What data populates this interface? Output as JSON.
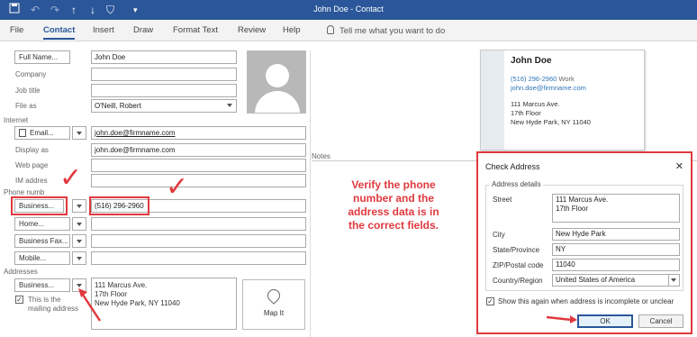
{
  "window": {
    "title": "John Doe  -  Contact"
  },
  "quick_access": [
    "save-icon",
    "undo-icon",
    "redo-icon",
    "up-arrow-icon",
    "down-arrow-icon",
    "tag-icon",
    "customize-icon"
  ],
  "ribbon": {
    "tabs": [
      "File",
      "Contact",
      "Insert",
      "Draw",
      "Format Text",
      "Review",
      "Help"
    ],
    "active_tab": "Contact",
    "tell_me": "Tell me what you want to do"
  },
  "form": {
    "full_name_button": "Full Name...",
    "full_name": "John Doe",
    "company_label": "Company",
    "company": "",
    "job_title_label": "Job title",
    "job_title": "",
    "file_as_label": "File as",
    "file_as": "O'Neill, Robert",
    "internet_section": "Internet",
    "email_button": "Email...",
    "email": "john.doe@firmname.com",
    "display_as_label": "Display as",
    "display_as": "john.doe@firmname.com",
    "web_page_label": "Web page",
    "im_address_label": "IM addres",
    "phone_section": "Phone numb",
    "phone_buttons": [
      "Business...",
      "Home...",
      "Business Fax...",
      "Mobile..."
    ],
    "phone_business": "(516) 296-2960",
    "addresses_section": "Addresses",
    "address_button": "Business...",
    "mailing_checkbox_mark": "✓",
    "mailing_label_line1": "This is the",
    "mailing_label_line2": "mailing address",
    "address_lines": [
      "111 Marcus Ave.",
      "17th Floor",
      "New Hyde Park, NY  11040"
    ],
    "map_it": "Map It",
    "notes_label": "Notes"
  },
  "annotation": {
    "text_lines": [
      "Verify the phone",
      "number and the",
      "address data is in",
      "the correct fields."
    ],
    "check_marks": [
      "✓",
      "✓",
      "✓"
    ]
  },
  "card": {
    "name": "John Doe",
    "phone": "(516) 296-2960",
    "phone_type": "Work",
    "email": "john.doe@firmname.com",
    "address_lines": [
      "111 Marcus Ave.",
      "17th Floor",
      "New Hyde Park, NY  11040"
    ]
  },
  "dialog": {
    "title": "Check Address",
    "close": "✕",
    "group_label": "Address details",
    "street_label": "Street",
    "street_lines": [
      "111 Marcus Ave.",
      "17th Floor"
    ],
    "city_label": "City",
    "city": "New Hyde Park",
    "state_label": "State/Province",
    "state": "NY",
    "zip_label": "ZIP/Postal code",
    "zip": "11040",
    "country_label": "Country/Region",
    "country": "United States of America",
    "show_again_mark": "✓",
    "show_again": "Show this again when address is incomplete or unclear",
    "ok": "OK",
    "cancel": "Cancel"
  },
  "colors": {
    "title_bar": "#2b579a",
    "accent_red": "#e0393e",
    "link_blue": "#2e75b6"
  }
}
